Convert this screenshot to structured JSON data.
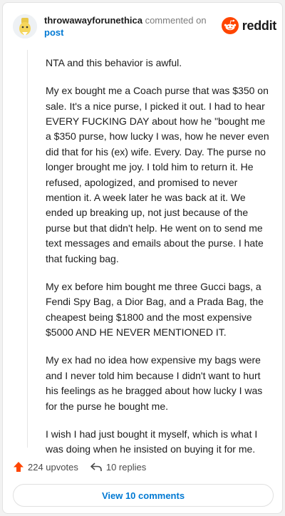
{
  "comment": {
    "author": "throwawayforunethica",
    "action_text": " commented on",
    "target_link": "post",
    "paragraphs": [
      "NTA and this behavior is awful.",
      "My ex bought me a Coach purse that was $350 on sale. It's a nice purse, I picked it out. I had to hear EVERY FUCKING DAY about how he \"bought me a $350 purse, how lucky I was, how he never even did that for his (ex) wife. Every. Day. The purse no longer brought me joy. I told him to return it. He refused, apologized, and promised to never mention it. A week later he was back at it. We ended up breaking up, not just because of the purse but that didn't help. He went on to send me text messages and emails about the purse. I hate that fucking bag.",
      "My ex before him bought me three Gucci bags, a Fendi Spy Bag, a Dior Bag, and a Prada Bag, the cheapest being $1800 and the most expensive $5000 AND HE NEVER MENTIONED IT.",
      "My ex had no idea how expensive my bags were and I never told him because I didn't want to hurt his feelings as he bragged about how lucky I was for the purse he bought me.",
      "I wish I had just bought it myself, which is what I was doing when he insisted on buying it for me."
    ]
  },
  "brand": {
    "name": "reddit",
    "accent": "#ff4500"
  },
  "actions": {
    "upvotes_label": "224 upvotes",
    "replies_label": "10 replies",
    "upvote_color": "#ff4500"
  },
  "footer": {
    "view_comments_label": "View 10 comments",
    "link_color": "#0079d3"
  },
  "icons": [
    "avatar",
    "reddit-logo-icon",
    "upvote-arrow-icon",
    "reply-arrow-icon"
  ]
}
